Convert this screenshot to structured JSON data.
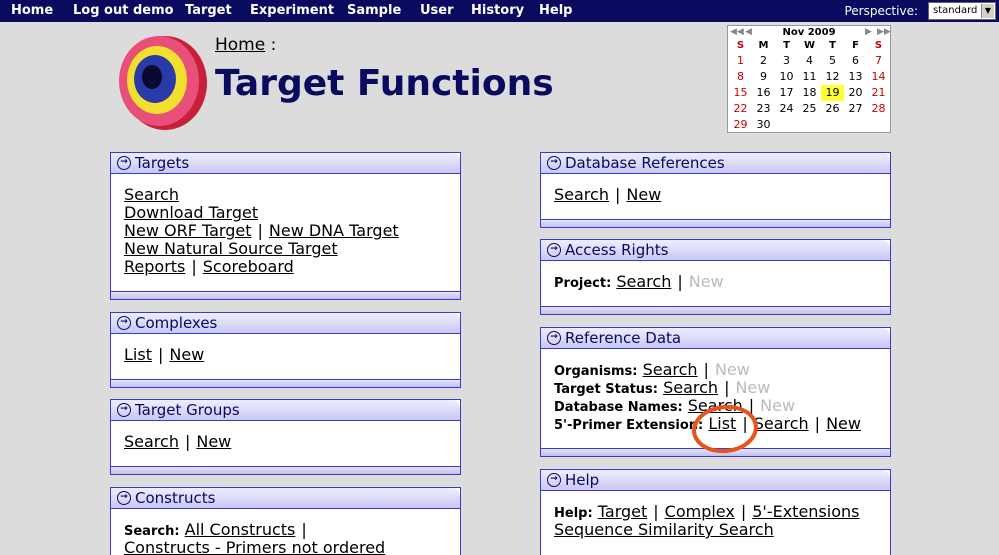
{
  "nav": {
    "items": [
      "Home",
      "Log out demo",
      "Target",
      "Experiment",
      "Sample",
      "User",
      "History",
      "Help"
    ],
    "perspective_label": "Perspective:",
    "perspective_value": "standard"
  },
  "header": {
    "breadcrumb_home": "Home",
    "breadcrumb_sep": ":",
    "title": "Target Functions"
  },
  "calendar": {
    "month": "Nov 2009",
    "days_of_week": [
      "S",
      "M",
      "T",
      "W",
      "T",
      "F",
      "S"
    ],
    "today": "19",
    "weeks": [
      [
        "1",
        "2",
        "3",
        "4",
        "5",
        "6",
        "7"
      ],
      [
        "8",
        "9",
        "10",
        "11",
        "12",
        "13",
        "14"
      ],
      [
        "15",
        "16",
        "17",
        "18",
        "19",
        "20",
        "21"
      ],
      [
        "22",
        "23",
        "24",
        "25",
        "26",
        "27",
        "28"
      ],
      [
        "29",
        "30",
        "",
        "",
        "",
        "",
        ""
      ]
    ]
  },
  "panels": {
    "targets": {
      "title": "Targets",
      "search": "Search",
      "download": "Download Target",
      "new_orf": "New ORF Target",
      "new_dna": "New DNA Target",
      "new_natural": "New Natural Source Target",
      "reports": "Reports",
      "scoreboard": "Scoreboard"
    },
    "complexes": {
      "title": "Complexes",
      "list": "List",
      "new": "New"
    },
    "target_groups": {
      "title": "Target Groups",
      "search": "Search",
      "new": "New"
    },
    "constructs": {
      "title": "Constructs",
      "search_label": "Search:",
      "all": "All Constructs",
      "primers_not_ordered": "Constructs - Primers not ordered"
    },
    "database_references": {
      "title": "Database References",
      "search": "Search",
      "new": "New"
    },
    "access_rights": {
      "title": "Access Rights",
      "project_label": "Project:",
      "search": "Search",
      "new": "New"
    },
    "reference_data": {
      "title": "Reference Data",
      "organisms_label": "Organisms:",
      "target_status_label": "Target Status:",
      "database_names_label": "Database Names:",
      "primer_label": "5'-Primer Extension:",
      "search": "Search",
      "new": "New",
      "list": "List"
    },
    "help": {
      "title": "Help",
      "help_label": "Help:",
      "target": "Target",
      "complex": "Complex",
      "extensions": "5'-Extensions",
      "similarity": "Sequence Similarity Search"
    }
  },
  "separator": "|",
  "colors": {
    "nav_bg": "#0a0a5e",
    "title": "#0a0a5e",
    "panel_border": "#3a3ad0",
    "annotation": "#e8531c",
    "today": "#ffff33"
  }
}
